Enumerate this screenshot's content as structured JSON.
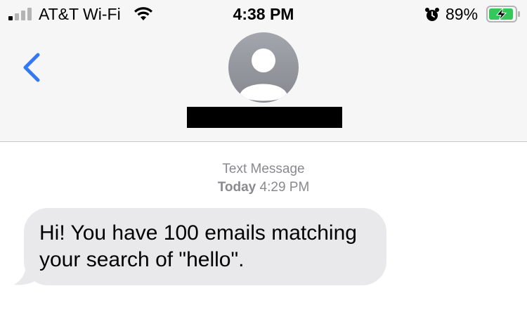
{
  "status_bar": {
    "carrier": "AT&T Wi-Fi",
    "time": "4:38 PM",
    "battery_percent": "89%",
    "signal_bars_active": 1,
    "signal_bars_total": 4,
    "battery_level": 0.89,
    "charging": true,
    "icons": [
      "cellular-signal-icon",
      "wifi-icon",
      "alarm-icon",
      "battery-charging-icon"
    ]
  },
  "nav": {
    "back_icon": "chevron-left-icon",
    "contact_avatar": "default-person-avatar",
    "contact_name": "",
    "contact_name_redacted": true,
    "accent_color": "#3478f6"
  },
  "conversation": {
    "service_label": "Text Message",
    "date_label": "Today",
    "date_time": "4:29 PM",
    "messages": [
      {
        "direction": "incoming",
        "text": "Hi! You have 100 emails matching your search of \"hello\".",
        "bubble_color": "#e9e9eb"
      }
    ]
  }
}
